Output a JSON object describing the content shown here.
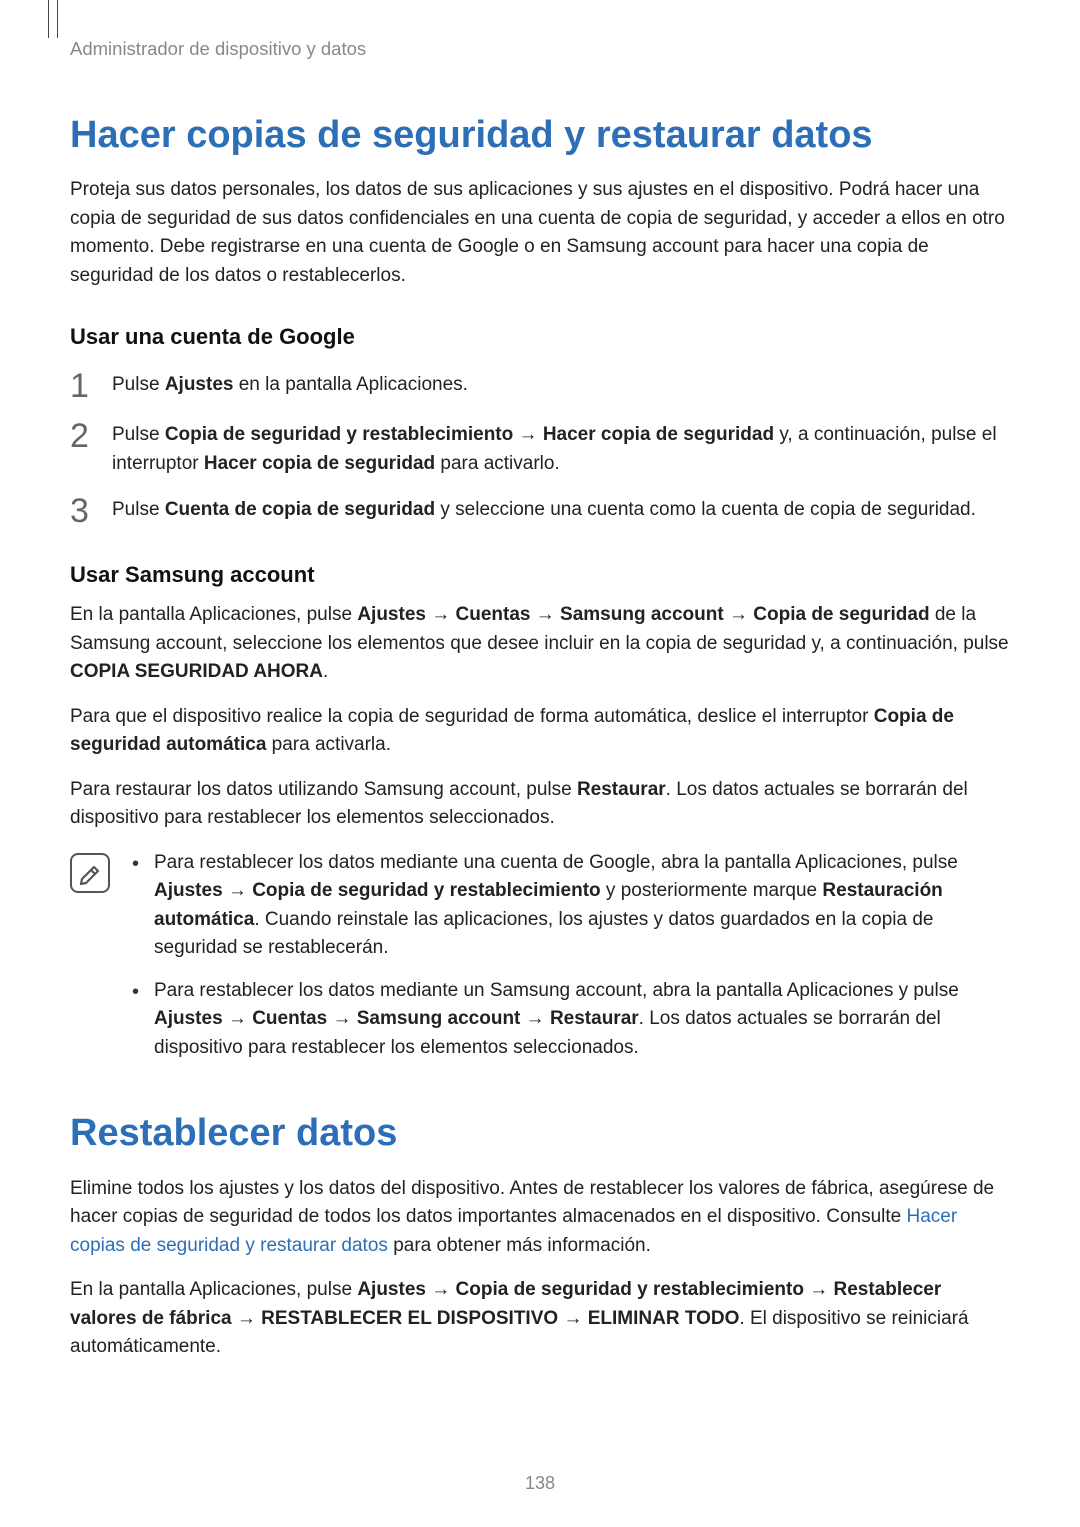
{
  "breadcrumb": "Administrador de dispositivo y datos",
  "section1": {
    "title": "Hacer copias de seguridad y restaurar datos",
    "intro": "Proteja sus datos personales, los datos de sus aplicaciones y sus ajustes en el dispositivo. Podrá hacer una copia de seguridad de sus datos confidenciales en una cuenta de copia de seguridad, y acceder a ellos en otro momento. Debe registrarse en una cuenta de Google o en Samsung account para hacer una copia de seguridad de los datos o restablecerlos.",
    "google": {
      "heading": "Usar una cuenta de Google",
      "step1": {
        "num": "1",
        "pre": "Pulse ",
        "b1": "Ajustes",
        "post": " en la pantalla Aplicaciones."
      },
      "step2": {
        "num": "2",
        "pre": "Pulse ",
        "b1": "Copia de seguridad y restablecimiento",
        "arrow1": " → ",
        "b2": "Hacer copia de seguridad",
        "mid": " y, a continuación, pulse el interruptor ",
        "b3": "Hacer copia de seguridad",
        "post": " para activarlo."
      },
      "step3": {
        "num": "3",
        "pre": "Pulse ",
        "b1": "Cuenta de copia de seguridad",
        "post": " y seleccione una cuenta como la cuenta de copia de seguridad."
      }
    },
    "samsung": {
      "heading": "Usar Samsung account",
      "p1": {
        "pre": "En la pantalla Aplicaciones, pulse ",
        "b1": "Ajustes",
        "a1": " → ",
        "b2": "Cuentas",
        "a2": " → ",
        "b3": "Samsung account",
        "a3": " → ",
        "b4": "Copia de seguridad",
        "mid": " de la Samsung account, seleccione los elementos que desee incluir en la copia de seguridad y, a continuación, pulse ",
        "b5": "COPIA SEGURIDAD AHORA",
        "post": "."
      },
      "p2": {
        "pre": "Para que el dispositivo realice la copia de seguridad de forma automática, deslice el interruptor ",
        "b1": "Copia de seguridad automática",
        "post": " para activarla."
      },
      "p3": {
        "pre": "Para restaurar los datos utilizando Samsung account, pulse ",
        "b1": "Restaurar",
        "post": ". Los datos actuales se borrarán del dispositivo para restablecer los elementos seleccionados."
      },
      "note1": {
        "pre": "Para restablecer los datos mediante una cuenta de Google, abra la pantalla Aplicaciones, pulse ",
        "b1": "Ajustes",
        "a1": " → ",
        "b2": "Copia de seguridad y restablecimiento",
        "mid": " y posteriormente marque ",
        "b3": "Restauración automática",
        "post": ". Cuando reinstale las aplicaciones, los ajustes y datos guardados en la copia de seguridad se restablecerán."
      },
      "note2": {
        "pre": "Para restablecer los datos mediante un Samsung account, abra la pantalla Aplicaciones y pulse ",
        "b1": "Ajustes",
        "a1": " → ",
        "b2": "Cuentas",
        "a2": " → ",
        "b3": "Samsung account",
        "a3": " → ",
        "b4": "Restaurar",
        "post": ". Los datos actuales se borrarán del dispositivo para restablecer los elementos seleccionados."
      }
    }
  },
  "section2": {
    "title": "Restablecer datos",
    "p1": {
      "pre": "Elimine todos los ajustes y los datos del dispositivo. Antes de restablecer los valores de fábrica, asegúrese de hacer copias de seguridad de todos los datos importantes almacenados en el dispositivo. Consulte ",
      "link": "Hacer copias de seguridad y restaurar datos",
      "post": " para obtener más información."
    },
    "p2": {
      "pre": "En la pantalla Aplicaciones, pulse ",
      "b1": "Ajustes",
      "a1": " → ",
      "b2": "Copia de seguridad y restablecimiento",
      "a2": " → ",
      "b3": "Restablecer valores de fábrica",
      "a3": " → ",
      "b4": "RESTABLECER EL DISPOSITIVO",
      "a4": " → ",
      "b5": "ELIMINAR TODO",
      "post": ". El dispositivo se reiniciará automáticamente."
    }
  },
  "page_number": "138"
}
